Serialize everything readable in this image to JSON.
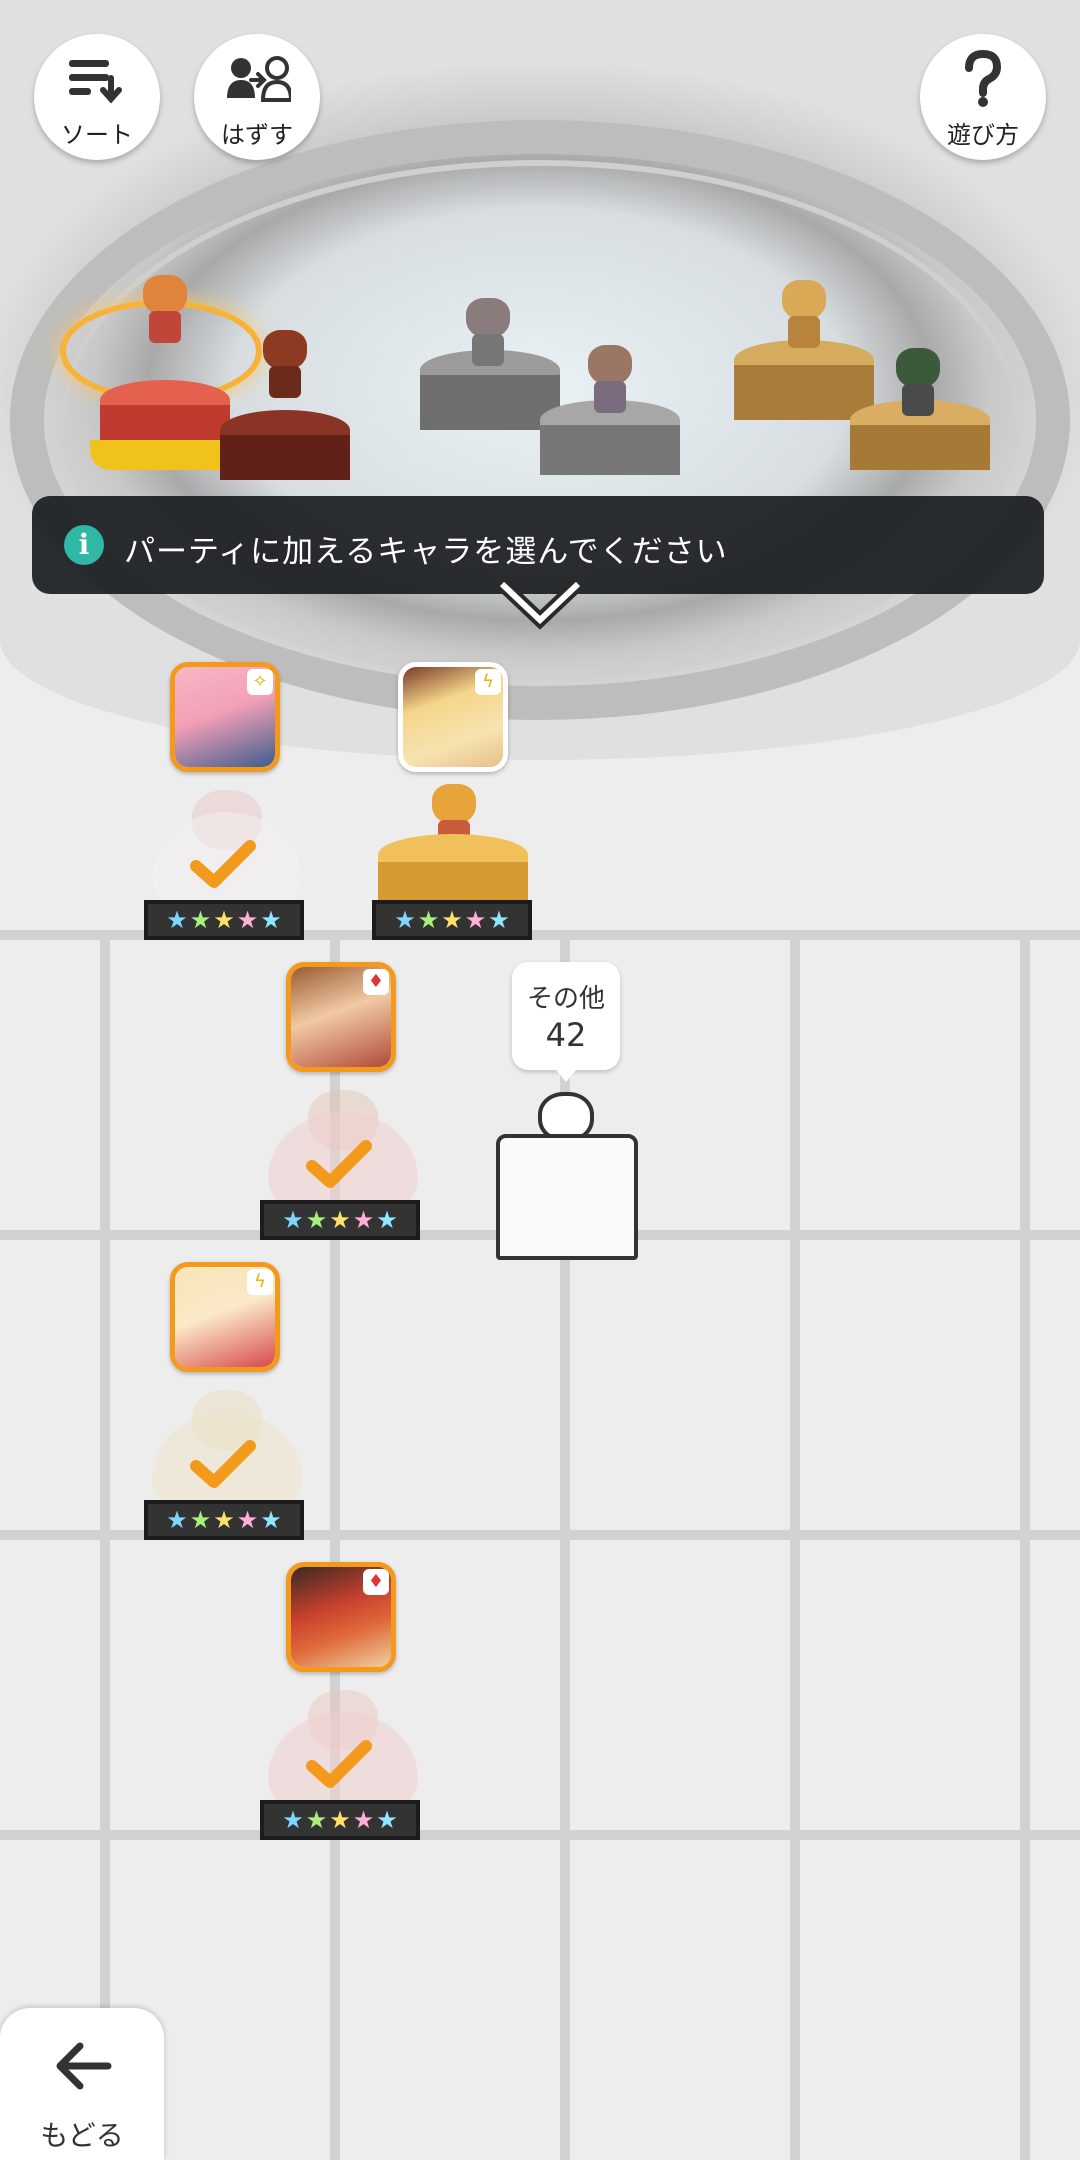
{
  "top_buttons": {
    "sort_label": "ソート",
    "remove_label": "はずす",
    "help_label": "遊び方"
  },
  "banner": {
    "message": "パーティに加えるキャラを選んでください"
  },
  "other": {
    "label": "その他",
    "count": "42"
  },
  "back": {
    "label": "もどる"
  },
  "characters": [
    {
      "id": "pink-hair-girl",
      "element": "light",
      "rarity": 5,
      "selected": true,
      "frame": "orange"
    },
    {
      "id": "blonde-girl-hat",
      "element": "thunder",
      "rarity": 5,
      "selected": false,
      "frame": "white"
    },
    {
      "id": "brown-hair-girl",
      "element": "fire",
      "rarity": 5,
      "selected": true,
      "frame": "orange"
    },
    {
      "id": "blonde-girl-twintail",
      "element": "thunder",
      "rarity": 5,
      "selected": true,
      "frame": "orange"
    },
    {
      "id": "red-dragon",
      "element": "fire",
      "rarity": 5,
      "selected": true,
      "frame": "orange"
    }
  ],
  "colors": {
    "accent_orange": "#f39a1d",
    "banner_bg": "#1e2124",
    "info_icon": "#2fb8a5"
  }
}
